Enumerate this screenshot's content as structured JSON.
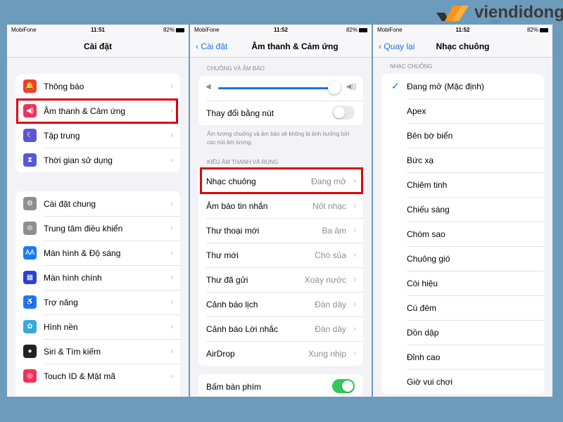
{
  "logo": {
    "brand": "viendidong",
    "suffix": ".com"
  },
  "status": [
    {
      "carrier": "MobiFone",
      "time": "11:51",
      "battery": "82%"
    },
    {
      "carrier": "MobiFone",
      "time": "11:52",
      "battery": "82%"
    },
    {
      "carrier": "MobiFone",
      "time": "11:52",
      "battery": "82%"
    }
  ],
  "settings": {
    "title": "Cài đặt",
    "group1": [
      {
        "label": "Thông báo",
        "icon": "bell",
        "color": "#f23b30"
      },
      {
        "label": "Âm thanh & Cảm ứng",
        "icon": "speaker",
        "color": "#f0325a",
        "highlighted": true
      },
      {
        "label": "Tập trung",
        "icon": "moon",
        "color": "#5b55d6"
      },
      {
        "label": "Thời gian sử dụng",
        "icon": "hourglass",
        "color": "#5b55d6"
      }
    ],
    "group2": [
      {
        "label": "Cài đặt chung",
        "icon": "gear",
        "color": "#8e8e93"
      },
      {
        "label": "Trung tâm điều khiển",
        "icon": "switches",
        "color": "#8e8e93"
      },
      {
        "label": "Màn hình & Độ sáng",
        "icon": "AA",
        "color": "#1a7cf5"
      },
      {
        "label": "Màn hình chính",
        "icon": "grid",
        "color": "#2d3fd6"
      },
      {
        "label": "Trợ năng",
        "icon": "accessibility",
        "color": "#1a7cf5"
      },
      {
        "label": "Hình nền",
        "icon": "flower",
        "color": "#35a9e0"
      },
      {
        "label": "Siri & Tìm kiếm",
        "icon": "siri",
        "color": "#222"
      },
      {
        "label": "Touch ID & Mật mã",
        "icon": "fingerprint",
        "color": "#f0325a"
      }
    ]
  },
  "sound": {
    "back": "Cài đặt",
    "title": "Âm thanh & Cảm ứng",
    "section1": "CHUÔNG VÀ ÂM BÁO",
    "volume": 0.97,
    "change_with_buttons": {
      "label": "Thay đổi bằng nút",
      "on": false
    },
    "footnote": "Âm lượng chuông và âm báo sẽ không bị ảnh hưởng bởi các nút âm lượng.",
    "section2": "KIỂU ÂM THANH VÀ RUNG",
    "items": [
      {
        "label": "Nhạc chuông",
        "value": "Đang mở"
      },
      {
        "label": "Âm báo tin nhắn",
        "value": "Nốt nhạc"
      },
      {
        "label": "Thư thoại mới",
        "value": "Ba âm"
      },
      {
        "label": "Thư mới",
        "value": "Chó sủa"
      },
      {
        "label": "Thư đã gửi",
        "value": "Xoáy nước"
      },
      {
        "label": "Cảnh báo lịch",
        "value": "Đàn dây"
      },
      {
        "label": "Cảnh báo Lời nhắc",
        "value": "Đàn dây"
      },
      {
        "label": "AirDrop",
        "value": "Xung nhịp"
      }
    ],
    "keyboard_clicks": {
      "label": "Bấm bàn phím",
      "on": true
    }
  },
  "ringtones": {
    "back": "Quay lại",
    "title": "Nhạc chuông",
    "section": "NHẠC CHUÔNG",
    "selected": 0,
    "items": [
      "Đang mở (Mặc định)",
      "Apex",
      "Bên bờ biển",
      "Bức xạ",
      "Chiêm tinh",
      "Chiếu sáng",
      "Chòm sao",
      "Chuông gió",
      "Còi hiệu",
      "Cú đêm",
      "Dồn dập",
      "Đỉnh cao",
      "Giờ vui chơi"
    ]
  },
  "colors": {
    "accent": "#1a73e8",
    "highlight": "#e0000b",
    "background": "#6d9bbb"
  }
}
